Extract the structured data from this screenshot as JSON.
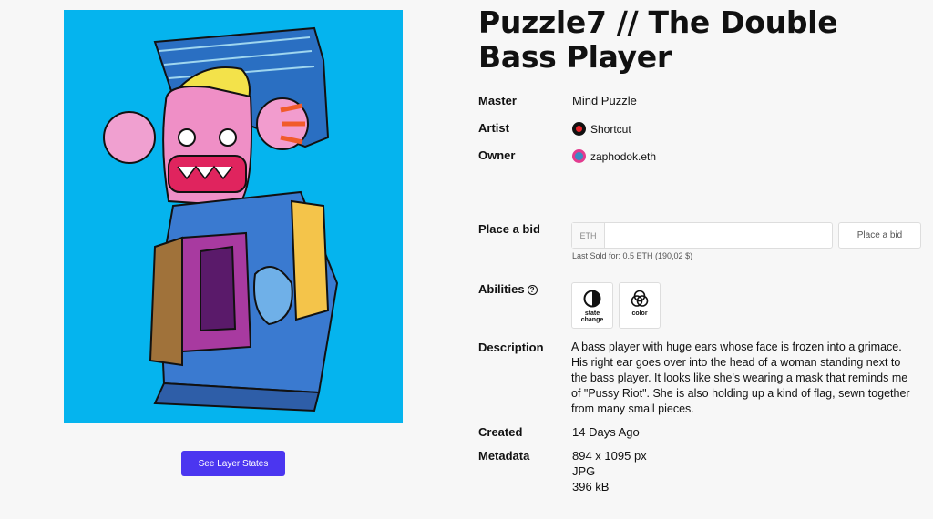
{
  "artwork": {
    "title": "Puzzle7 // The Double Bass Player",
    "layer_button_label": "See Layer States"
  },
  "details": {
    "master_label": "Master",
    "master_value": "Mind Puzzle",
    "artist_label": "Artist",
    "artist_name": "Shortcut",
    "owner_label": "Owner",
    "owner_name": "zaphodok.eth"
  },
  "bid": {
    "label": "Place a bid",
    "currency": "ETH",
    "input_value": "",
    "button_label": "Place a bid",
    "last_sold": "Last Sold for: 0.5 ETH (190,02 $)"
  },
  "abilities": {
    "label": "Abilities",
    "help_glyph": "?",
    "items": [
      {
        "label_line1": "state",
        "label_line2": "change",
        "icon": "half-circle-icon"
      },
      {
        "label_line1": "color",
        "label_line2": "",
        "icon": "color-circles-icon"
      }
    ]
  },
  "description": {
    "label": "Description",
    "text": "A bass player with huge ears whose face is frozen into a grimace. His right ear goes over into the head of a woman standing next to the bass player. It looks like she's wearing a mask that reminds me of \"Pussy Riot\". She is also holding up a kind of flag, sewn together from many small pieces."
  },
  "created": {
    "label": "Created",
    "value": "14 Days Ago"
  },
  "metadata": {
    "label": "Metadata",
    "dimensions": "894 x 1095 px",
    "format": "JPG",
    "size": "396 kB"
  },
  "colors": {
    "accent": "#4b36f0",
    "art_background": "#05b4ee"
  }
}
